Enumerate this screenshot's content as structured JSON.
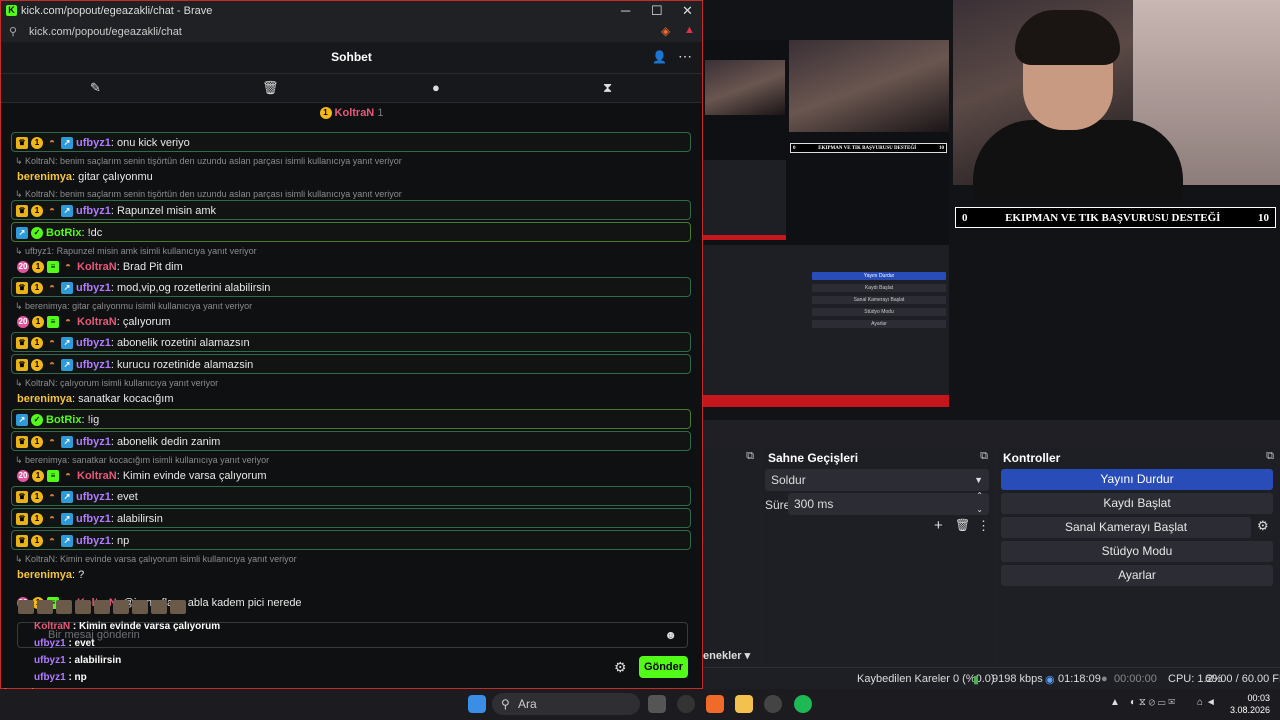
{
  "browser": {
    "title": "kick.com/popout/egeazakli/chat - Brave",
    "url": "kick.com/popout/egeazakli/chat",
    "chat_title": "Sohbet",
    "pinned_user": "KoltraN",
    "pinned_badge": "1",
    "input_placeholder": "Bir mesaj gönderin",
    "send_label": "Gönder"
  },
  "chat": {
    "messages": [
      {
        "type": "msg",
        "boxed": true,
        "user": "ufbyz1",
        "text": ": onu kick veriyo",
        "badges": [
          "crown",
          "coin",
          "hat",
          "arrow"
        ]
      },
      {
        "type": "reply",
        "text": "KoltraN: benim saçlarım senin tişörtün den uzundu aslan parçası isimli kullanıcıya yanıt veriyor"
      },
      {
        "type": "msg",
        "boxed": false,
        "user": "berenimya",
        "text": ": gitar çalıyonmu",
        "badges": []
      },
      {
        "type": "reply",
        "text": "KoltraN: benim saçlarım senin tişörtün den uzundu aslan parçası isimli kullanıcıya yanıt veriyor"
      },
      {
        "type": "msg",
        "boxed": true,
        "user": "ufbyz1",
        "text": ": Rapunzel misin amk",
        "badges": [
          "crown",
          "coin",
          "hat",
          "arrow"
        ]
      },
      {
        "type": "msg",
        "boxed": true,
        "green": true,
        "user": "BotRix",
        "text": ": !dc",
        "badges": [
          "arrow",
          "bot"
        ]
      },
      {
        "type": "reply",
        "text": "ufbyz1: Rapunzel misin amk isimli kullanıcıya yanıt veriyor"
      },
      {
        "type": "msg",
        "boxed": false,
        "user": "KoltraN",
        "text": ": Brad Pit dim",
        "badges": [
          "sub",
          "coin",
          "stack",
          "hat"
        ]
      },
      {
        "type": "msg",
        "boxed": true,
        "user": "ufbyz1",
        "text": ": mod,vip,og rozetlerini alabilirsin",
        "badges": [
          "crown",
          "coin",
          "hat",
          "arrow"
        ]
      },
      {
        "type": "reply",
        "text": "berenimya: gitar çalıyonmu isimli kullanıcıya yanıt veriyor"
      },
      {
        "type": "msg",
        "boxed": false,
        "user": "KoltraN",
        "text": ": çalıyorum",
        "badges": [
          "sub",
          "coin",
          "stack",
          "hat"
        ]
      },
      {
        "type": "msg",
        "boxed": true,
        "user": "ufbyz1",
        "text": ": abonelik rozetini alamazsın",
        "badges": [
          "crown",
          "coin",
          "hat",
          "arrow"
        ]
      },
      {
        "type": "msg",
        "boxed": true,
        "user": "ufbyz1",
        "text": ": kurucu rozetinide alamazsin",
        "badges": [
          "crown",
          "coin",
          "hat",
          "arrow"
        ]
      },
      {
        "type": "reply",
        "text": "KoltraN: çalıyorum isimli kullanıcıya yanıt veriyor"
      },
      {
        "type": "msg",
        "boxed": false,
        "user": "berenimya",
        "text": ": sanatkar kocacığım",
        "badges": []
      },
      {
        "type": "msg",
        "boxed": true,
        "green": true,
        "user": "BotRix",
        "text": ": !ig",
        "badges": [
          "arrow",
          "bot"
        ]
      },
      {
        "type": "msg",
        "boxed": true,
        "user": "ufbyz1",
        "text": ": abonelik dedin zanim",
        "badges": [
          "crown",
          "coin",
          "hat",
          "arrow"
        ]
      },
      {
        "type": "reply",
        "text": "berenimya: sanatkar kocacığım isimli kullanıcıya yanıt veriyor"
      },
      {
        "type": "msg",
        "boxed": false,
        "user": "KoltraN",
        "text": ": Kimin evinde varsa çalıyorum",
        "badges": [
          "sub",
          "coin",
          "stack",
          "hat"
        ]
      },
      {
        "type": "msg",
        "boxed": true,
        "user": "ufbyz1",
        "text": ": evet",
        "badges": [
          "crown",
          "coin",
          "hat",
          "arrow"
        ]
      },
      {
        "type": "msg",
        "boxed": true,
        "user": "ufbyz1",
        "text": ": alabilirsin",
        "badges": [
          "crown",
          "coin",
          "hat",
          "arrow"
        ]
      },
      {
        "type": "msg",
        "boxed": true,
        "user": "ufbyz1",
        "text": ": np",
        "badges": [
          "crown",
          "coin",
          "hat",
          "arrow"
        ]
      },
      {
        "type": "reply",
        "text": "KoltraN: Kimin evinde varsa çalıyorum isimli kullanıcıya yanıt veriyor"
      },
      {
        "type": "msg",
        "boxed": false,
        "user": "berenimya",
        "text": ": ?",
        "badges": []
      },
      {
        "type": "gap"
      },
      {
        "type": "msg",
        "boxed": false,
        "user": "KoltraN",
        "text": ": @iremoflayn abla kadem pici nerede",
        "badges": [
          "sub",
          "coin",
          "stack",
          "hat"
        ]
      }
    ]
  },
  "overlay": {
    "lines": [
      {
        "user": "KoltraN",
        "text": " : Kimin evinde varsa çalıyorum"
      },
      {
        "user": "ufbyz1",
        "text": " : evet"
      },
      {
        "user": "ufbyz1",
        "text": " : alabilirsin"
      },
      {
        "user": "ufbyz1",
        "text": " : np"
      },
      {
        "user": "berenimya",
        "text": " : ?"
      },
      {
        "user": "KoltraN",
        "text": " : @iremoflayn abla kadem pici nerede"
      }
    ]
  },
  "obs": {
    "banner_left": "0",
    "banner_text": "EKIPMAN VE TIK BAŞVURUSU DESTEĞİ",
    "banner_right": "10",
    "transitions_title": "Sahne Geçişleri",
    "transition_value": "Soldur",
    "duration_label": "Süre",
    "duration_value": "300 ms",
    "controls_title": "Kontroller",
    "controls": [
      "Yayını Durdur",
      "Kaydı Başlat",
      "Sanal Kamerayı Başlat",
      "Stüdyo Modu",
      "Ayarlar"
    ],
    "options_label": "enekler",
    "status": {
      "dropped": "Kaybedilen Kareler 0 (%0.0)",
      "bitrate": "9198 kbps",
      "stream_time": "01:18:09",
      "rec_time": "00:00:00",
      "cpu": "CPU: 1.2%",
      "fps": "60.00 / 60.00 FPS"
    }
  },
  "taskbar": {
    "search_placeholder": "Ara",
    "time": "00:03",
    "date": "3.08.2026"
  }
}
